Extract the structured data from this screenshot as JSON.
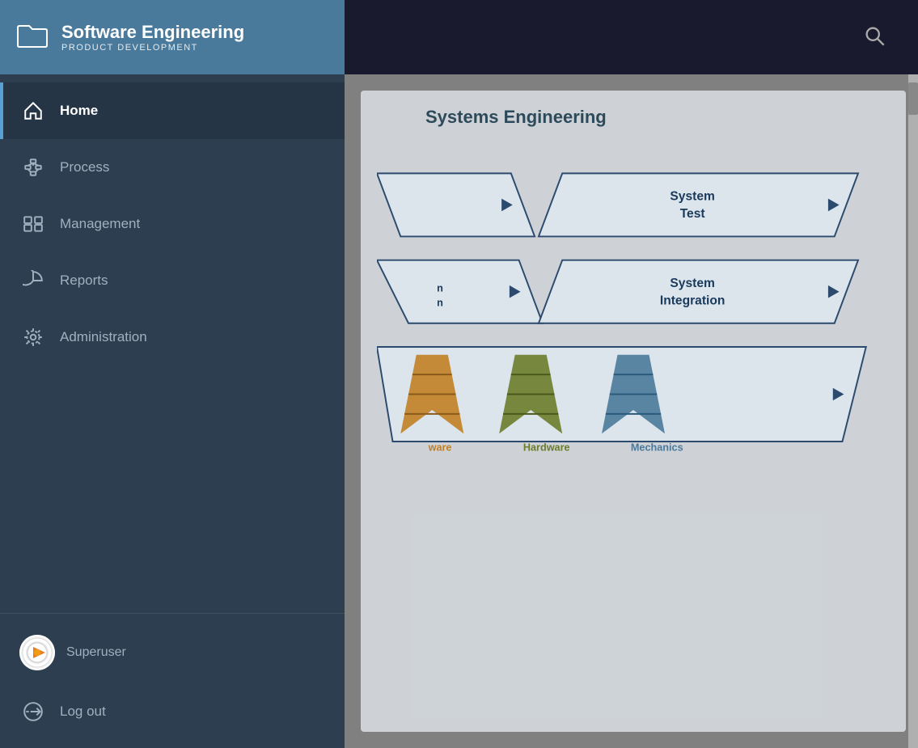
{
  "header": {
    "title": "Software Engineering",
    "subtitle": "PRODUCT DEVELOPMENT",
    "search_label": "search"
  },
  "sidebar": {
    "items": [
      {
        "id": "home",
        "label": "Home",
        "active": true
      },
      {
        "id": "process",
        "label": "Process",
        "active": false
      },
      {
        "id": "management",
        "label": "Management",
        "active": false
      },
      {
        "id": "reports",
        "label": "Reports",
        "active": false
      },
      {
        "id": "administration",
        "label": "Administration",
        "active": false
      }
    ],
    "user": {
      "name": "Superuser"
    },
    "logout_label": "Log out"
  },
  "content": {
    "diagram_title": "Systems Engineering",
    "shapes": [
      {
        "id": "system_test",
        "label": "System\nTest"
      },
      {
        "id": "system_integration",
        "label": "System\nIntegration"
      }
    ],
    "v_logos": [
      {
        "id": "software",
        "label": "ware",
        "color": "#c17f24"
      },
      {
        "id": "hardware",
        "label": "Hardware",
        "color": "#6b7c2a"
      },
      {
        "id": "mechanics",
        "label": "Mechanics",
        "color": "#4a7a9b"
      }
    ]
  }
}
